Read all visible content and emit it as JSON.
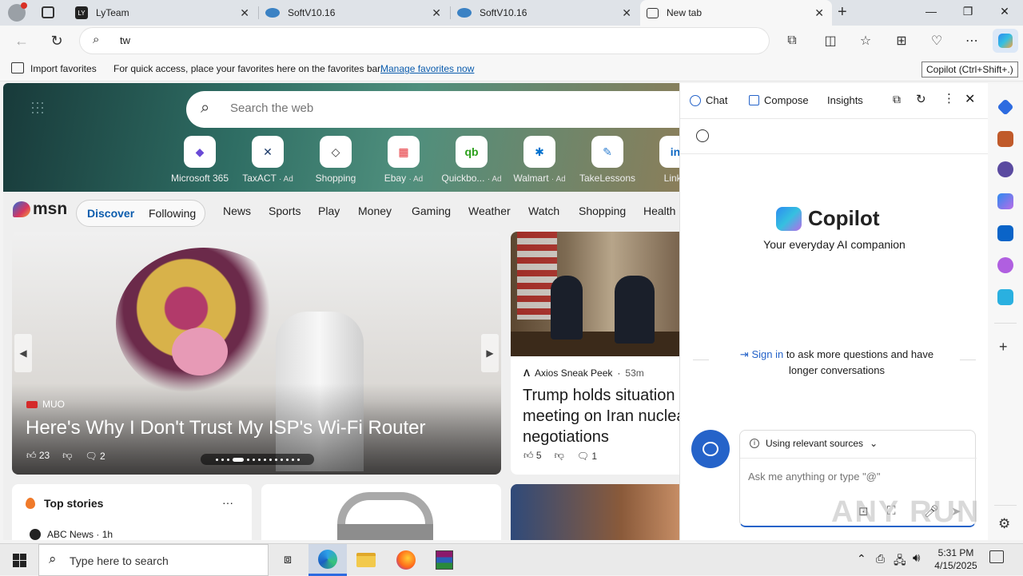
{
  "tabs": [
    {
      "label": "LyTeam",
      "icon": "lyteam-icon"
    },
    {
      "label": "SoftV10.16",
      "icon": "softv-icon"
    },
    {
      "label": "SoftV10.16",
      "icon": "softv-icon"
    },
    {
      "label": "New tab",
      "icon": "newtab-icon"
    }
  ],
  "address": {
    "value": "tw"
  },
  "tooltip": "Copilot (Ctrl+Shift+.)",
  "favbar": {
    "import_label": "Import favorites",
    "hint": "For quick access, place your favorites here on the favorites bar.",
    "manage_link": "Manage favorites now"
  },
  "search": {
    "placeholder": "Search the web"
  },
  "quicklinks": [
    {
      "label": "Microsoft 365",
      "ad": "",
      "color": "#6a4ad6",
      "glyph": "◆"
    },
    {
      "label": "TaxACT",
      "ad": "· Ad",
      "color": "#1d3b6a",
      "glyph": "✕"
    },
    {
      "label": "Shopping",
      "ad": "",
      "color": "#333333",
      "glyph": "◇"
    },
    {
      "label": "Ebay",
      "ad": "· Ad",
      "color": "#e53238",
      "glyph": "▦"
    },
    {
      "label": "Quickbo...",
      "ad": "· Ad",
      "color": "#2ca01c",
      "glyph": "qb"
    },
    {
      "label": "Walmart",
      "ad": "· Ad",
      "color": "#0071ce",
      "glyph": "✱"
    },
    {
      "label": "TakeLessons",
      "ad": "",
      "color": "#2f7fd0",
      "glyph": "✎"
    },
    {
      "label": "Linke",
      "ad": "",
      "color": "#0a66c2",
      "glyph": "in"
    }
  ],
  "msn": {
    "logo": "msn",
    "discover": "Discover",
    "following": "Following",
    "nav": [
      "News",
      "Sports",
      "Play",
      "Money",
      "Gaming",
      "Weather",
      "Watch",
      "Shopping",
      "Health"
    ]
  },
  "hero": {
    "source": "MUO",
    "title": "Here's Why I Don't Trust My ISP's Wi-Fi Router",
    "likes": "23",
    "comments": "2"
  },
  "news2": {
    "source": "Axios Sneak Peek",
    "age": "53m",
    "title": "Trump holds situation meeting on Iran nuclear negotiations",
    "likes": "5",
    "comments": "1"
  },
  "topstories": {
    "title": "Top stories",
    "more": "···",
    "first_source": "ABC News",
    "first_age": "· 1h"
  },
  "copilot": {
    "tab_chat": "Chat",
    "tab_compose": "Compose",
    "tab_insights": "Insights",
    "brand": "Copilot",
    "tagline": "Your everyday AI companion",
    "signin": "Sign in",
    "signin_rest": "to ask more questions and have longer conversations",
    "sources": "Using relevant sources",
    "input_placeholder": "Ask me anything or type \"@\""
  },
  "taskbar": {
    "search_placeholder": "Type here to search",
    "time": "5:31 PM",
    "date": "4/15/2025"
  },
  "watermark": "ANY RUN"
}
